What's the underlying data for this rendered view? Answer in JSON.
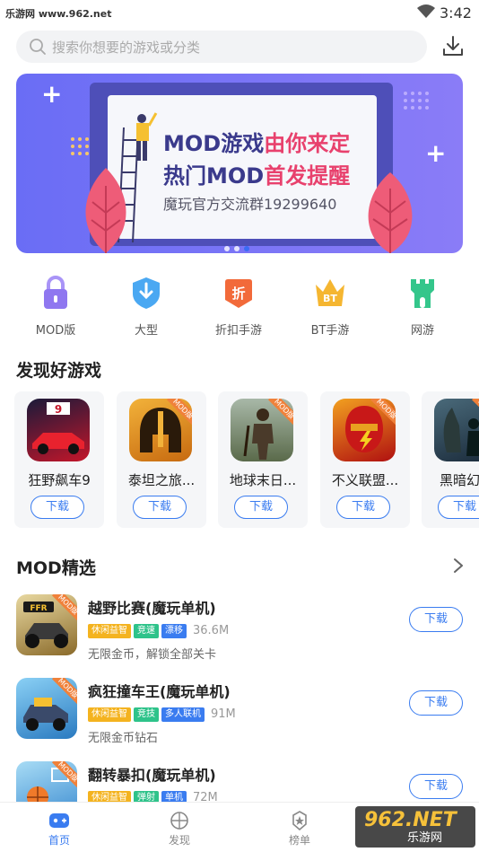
{
  "status_bar": {
    "site": "乐游网 www.962.net",
    "time": "3:42"
  },
  "search": {
    "placeholder": "搜索你想要的游戏或分类"
  },
  "banner": {
    "line1_a": "MOD游戏",
    "line1_b": "由你来定",
    "line2_a": "热门MOD",
    "line2_b": "首发提醒",
    "line3": "魔玩官方交流群19299640",
    "page_count": 3,
    "active_page": 3
  },
  "categories": [
    {
      "label": "MOD版",
      "icon": "lock-icon",
      "color": "#8f77f0"
    },
    {
      "label": "大型",
      "icon": "shield-icon",
      "color": "#4aa8f2"
    },
    {
      "label": "折扣手游",
      "icon": "discount-icon",
      "color": "#f26a3a"
    },
    {
      "label": "BT手游",
      "icon": "crown-icon",
      "color": "#f5b631"
    },
    {
      "label": "网游",
      "icon": "castle-icon",
      "color": "#34c68b"
    }
  ],
  "discover": {
    "title": "发现好游戏",
    "download_label": "下载",
    "mod_badge": "MOD版",
    "games": [
      {
        "name": "狂野飙车9",
        "mod": false,
        "icon": "racing-car-icon",
        "color": "#c4162a"
      },
      {
        "name": "泰坦之旅...",
        "mod": true,
        "icon": "spartan-helmet-icon",
        "color": "#e8a020"
      },
      {
        "name": "地球末日...",
        "mod": true,
        "icon": "survivor-icon",
        "color": "#7a8a6a"
      },
      {
        "name": "不义联盟...",
        "mod": true,
        "icon": "flash-hero-icon",
        "color": "#d02020"
      },
      {
        "name": "黑暗幻想",
        "mod": true,
        "icon": "dark-monster-icon",
        "color": "#2e4a5a"
      }
    ]
  },
  "mod_picks": {
    "title": "MOD精选",
    "download_label": "下载",
    "mod_badge": "MOD版",
    "items": [
      {
        "title": "越野比赛(魔玩单机)",
        "tags": [
          "休闲益智",
          "竞速",
          "漂移"
        ],
        "size": "36.6M",
        "desc": "无限金币，解锁全部关卡",
        "icon": "offroad-buggy-icon",
        "color": "#c8a24a"
      },
      {
        "title": "疯狂撞车王(魔玩单机)",
        "tags": [
          "休闲益智",
          "竞技",
          "多人联机"
        ],
        "size": "91M",
        "desc": "无限金币钻石",
        "icon": "crash-car-icon",
        "color": "#4fa8e8"
      },
      {
        "title": "翻转暴扣(魔玩单机)",
        "tags": [
          "休闲益智",
          "弹射",
          "单机"
        ],
        "size": "72M",
        "desc": "",
        "icon": "basketball-icon",
        "color": "#5ab0e6"
      }
    ]
  },
  "bottom_nav": [
    {
      "label": "首页",
      "icon": "home-gamepad-icon",
      "active": true
    },
    {
      "label": "发现",
      "icon": "discover-icon",
      "active": false
    },
    {
      "label": "榜单",
      "icon": "ranking-star-icon",
      "active": false
    }
  ],
  "watermark": {
    "big": "962.NET",
    "small": "乐游网"
  },
  "colors": {
    "accent": "#3a7cf0",
    "banner_start": "#6a6df5",
    "banner_end": "#8a7cf7",
    "highlight": "#e8416d"
  }
}
